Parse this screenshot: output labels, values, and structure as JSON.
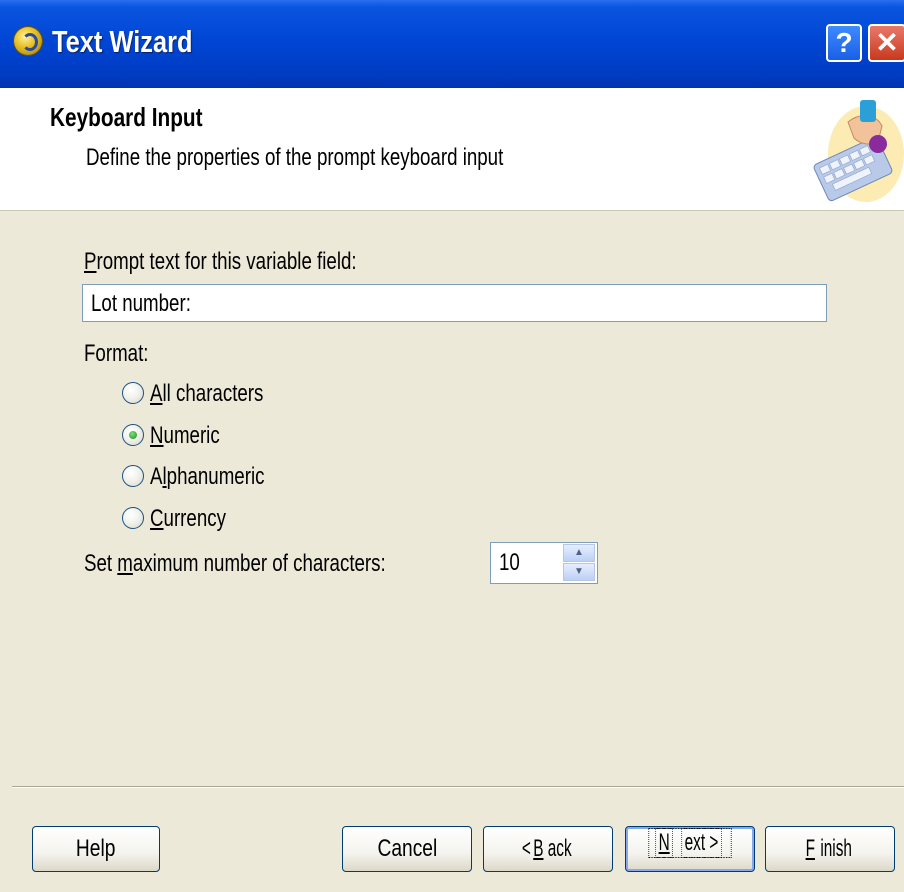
{
  "window": {
    "title": "Text Wizard",
    "help_glyph": "?",
    "close_glyph": "✕"
  },
  "header": {
    "title": "Keyboard Input",
    "subtitle": "Define the properties of the prompt keyboard input",
    "graphic_icon": "keyboard-hand-icon"
  },
  "prompt": {
    "label_u": "P",
    "label_rest": "rompt text for this variable field:",
    "value": "Lot number:"
  },
  "format": {
    "label": "Format:",
    "options": [
      {
        "u": "A",
        "rest": "ll characters",
        "checked": false
      },
      {
        "u": "N",
        "rest": "umeric",
        "checked": true
      },
      {
        "u": "",
        "pre": "A",
        "u2": "l",
        "rest": "phanumeric",
        "checked": false
      },
      {
        "u": "C",
        "rest": "urrency",
        "checked": false
      }
    ]
  },
  "max_chars": {
    "label_pre": "Set ",
    "label_u": "m",
    "label_rest": "aximum number of characters:",
    "value": "10"
  },
  "buttons": {
    "help": "Help",
    "cancel": "Cancel",
    "back_pre": "< ",
    "back_u": "B",
    "back_rest": "ack",
    "next_u": "N",
    "next_rest": "ext >",
    "finish_u": "F",
    "finish_rest": "inish"
  },
  "colors": {
    "titlebar": "#0046d5",
    "dialog_bg": "#ECE9D8",
    "header_bg": "#FFFFFF"
  }
}
